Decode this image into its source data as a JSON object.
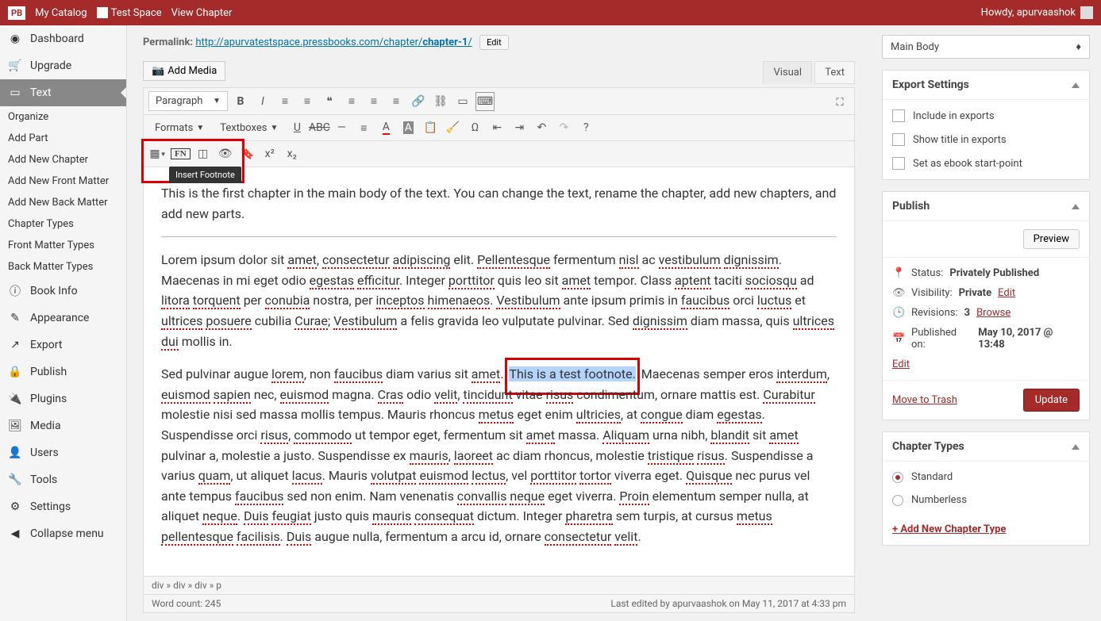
{
  "topbar": {
    "logo": "PB",
    "catalog": "My Catalog",
    "space": "Test Space",
    "view": "View Chapter",
    "greeting": "Howdy, apurvaashok"
  },
  "sidebar": {
    "dashboard": "Dashboard",
    "upgrade": "Upgrade",
    "text": "Text",
    "subs": [
      "Organize",
      "Add Part",
      "Add New Chapter",
      "Add New Front Matter",
      "Add New Back Matter",
      "Chapter Types",
      "Front Matter Types",
      "Back Matter Types"
    ],
    "bookinfo": "Book Info",
    "appearance": "Appearance",
    "export": "Export",
    "publish": "Publish",
    "plugins": "Plugins",
    "media": "Media",
    "users": "Users",
    "tools": "Tools",
    "settings": "Settings",
    "collapse": "Collapse menu"
  },
  "permalink": {
    "label": "Permalink:",
    "base": "http://apurvatestspace.pressbooks.com/chapter/",
    "slug": "chapter-1",
    "trail": "/",
    "edit": "Edit"
  },
  "editor": {
    "addMedia": "Add Media",
    "tabVisual": "Visual",
    "tabText": "Text",
    "paragraph": "Paragraph",
    "formats": "Formats",
    "textboxes": "Textboxes",
    "fn": "FN",
    "tooltip": "Insert Footnote",
    "para1a": "This is the first chapter in the main body of the text. You can change the text, rename the chapter, add new chapters, and add new parts.",
    "selected": "This is a test footnote.",
    "pathbar": "div » div » div » p",
    "wordcount": "Word count: 245",
    "lastedit": "Last edited by apurvaashok on May 11, 2017 at 4:33 pm"
  },
  "right": {
    "mainbody": "Main Body",
    "exportSettings": "Export Settings",
    "includeExports": "Include in exports",
    "showTitle": "Show title in exports",
    "ebookStart": "Set as ebook start-point",
    "publish": "Publish",
    "preview": "Preview",
    "statusLabel": "Status:",
    "statusVal": "Privately Published",
    "visLabel": "Visibility:",
    "visVal": "Private",
    "editLink": "Edit",
    "revLabel": "Revisions:",
    "revVal": "3",
    "browse": "Browse",
    "pubOnLabel": "Published on:",
    "pubOnVal": "May 10, 2017 @ 13:48",
    "trash": "Move to Trash",
    "update": "Update",
    "chapterTypes": "Chapter Types",
    "standard": "Standard",
    "numberless": "Numberless",
    "addType": "+ Add New Chapter Type"
  }
}
